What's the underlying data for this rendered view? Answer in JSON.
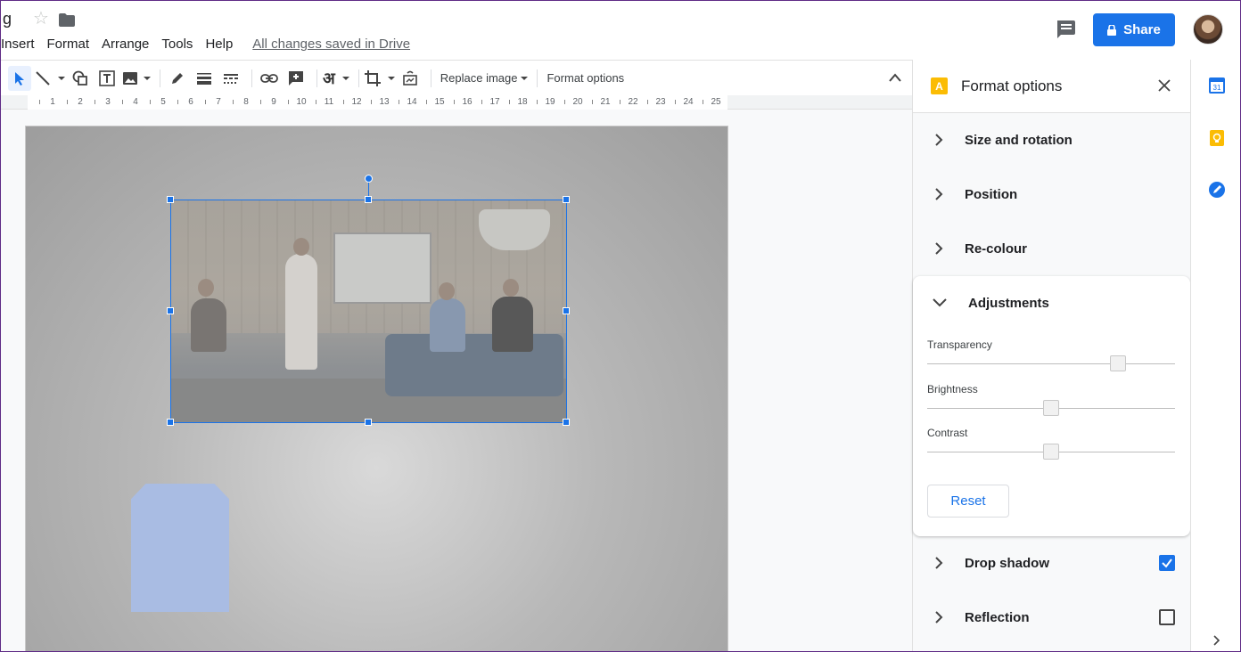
{
  "header": {
    "doc_title": "g",
    "menu": [
      "Insert",
      "Format",
      "Arrange",
      "Tools",
      "Help"
    ],
    "save_status": "All changes saved in Drive",
    "share_label": "Share"
  },
  "toolbar": {
    "replace_image_label": "Replace image",
    "format_options_label": "Format options",
    "hindi_glyph": "अ"
  },
  "ruler": {
    "numbers": [
      "1",
      "2",
      "3",
      "4",
      "5",
      "6",
      "7",
      "8",
      "9",
      "10",
      "11",
      "12",
      "13",
      "14",
      "15",
      "16",
      "17",
      "18",
      "19",
      "20",
      "21",
      "22",
      "23",
      "24",
      "25"
    ]
  },
  "format_panel": {
    "title": "Format options",
    "icon_letter": "A",
    "sections": {
      "size_rotation": "Size and rotation",
      "position": "Position",
      "recolour": "Re-colour",
      "adjustments": "Adjustments",
      "drop_shadow": "Drop shadow",
      "reflection": "Reflection"
    },
    "adjustments": {
      "transparency_label": "Transparency",
      "transparency_level": 0.77,
      "brightness_label": "Brightness",
      "brightness_level": 0.5,
      "contrast_label": "Contrast",
      "contrast_level": 0.5,
      "reset_label": "Reset"
    },
    "drop_shadow_checked": true,
    "reflection_checked": false
  },
  "rail": {
    "calendar_day": "31"
  },
  "colors": {
    "accent": "#1a73e8",
    "panel_icon": "#fbbc04"
  }
}
